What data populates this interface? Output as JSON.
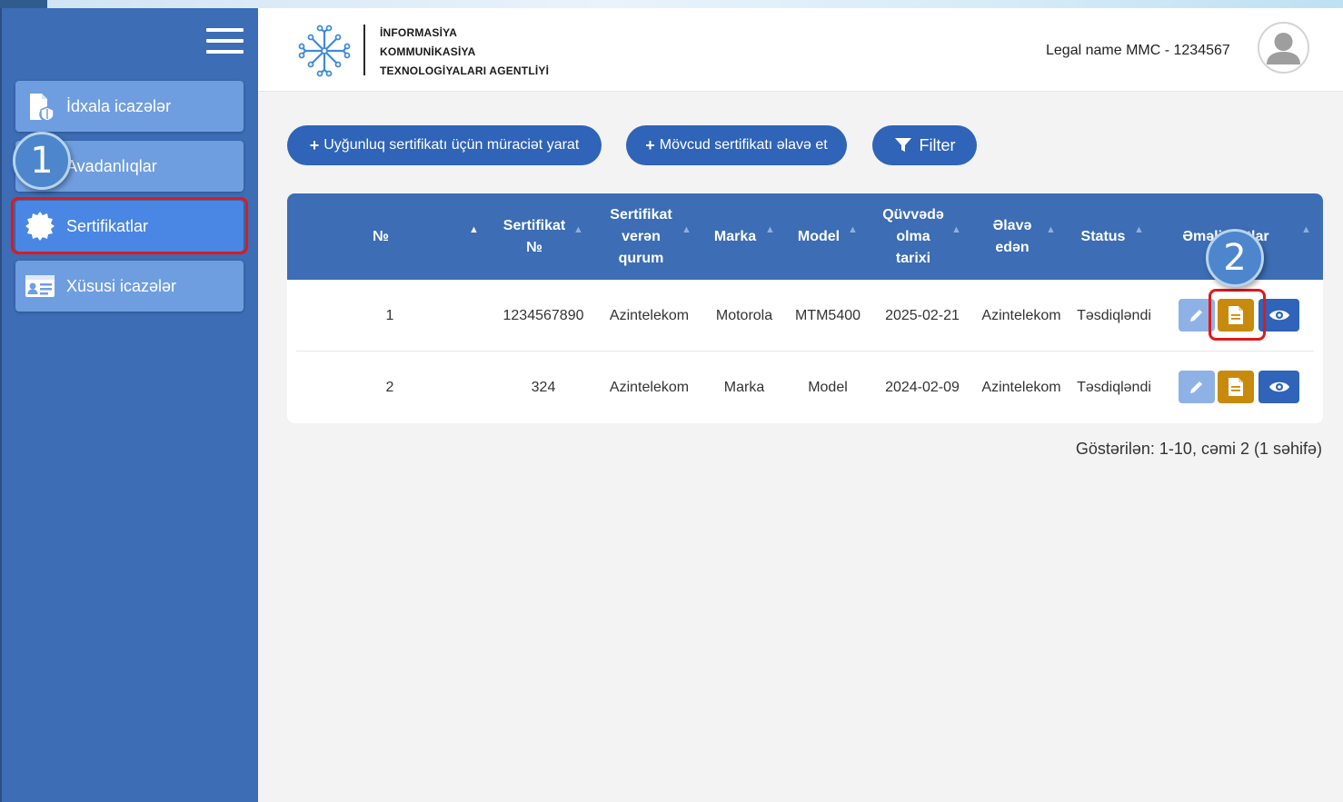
{
  "sidebar": {
    "items": [
      {
        "label": "İdxala icazələr",
        "icon": "import-permit-icon"
      },
      {
        "label": "Avadanlıqlar",
        "icon": "equipment-icon"
      },
      {
        "label": "Sertifikatlar",
        "icon": "certificate-badge-icon",
        "active": true
      },
      {
        "label": "Xüsusi icazələr",
        "icon": "id-card-icon"
      }
    ]
  },
  "header": {
    "agency_lines": [
      "İNFORMASİYA",
      "KOMMUNİKASİYA",
      "TEXNOLOGİYALARI AGENTLİYİ"
    ],
    "legal_name": "Legal name MMC - 1234567"
  },
  "toolbar": {
    "create_label": "Uyğunluq sertifikatı üçün müraciət yarat",
    "add_existing_label": "Mövcud sertifikatı əlavə et",
    "filter_label": "Filter"
  },
  "table": {
    "columns": [
      "№",
      "Sertifikat №",
      "Sertifikat verən qurum",
      "Marka",
      "Model",
      "Qüvvədə olma tarixi",
      "Əlavə edən",
      "Status",
      "Əməliyyatlar"
    ],
    "column_lines": {
      "cert_no": [
        "Sertifikat",
        "№"
      ],
      "issuer": [
        "Sertifikat",
        "verən",
        "qurum"
      ],
      "valid": [
        "Qüvvədə",
        "olma",
        "tarixi"
      ],
      "added_by": [
        "Əlavə",
        "edən"
      ]
    },
    "rows": [
      {
        "no": "1",
        "cert_no": "1234567890",
        "issuer": "Azintelekom",
        "brand": "Motorola",
        "model": "MTM5400",
        "valid_date": "2025-02-21",
        "added_by": "Azintelekom",
        "status": "Təsdiqləndi"
      },
      {
        "no": "2",
        "cert_no": "324",
        "issuer": "Azintelekom",
        "brand": "Marka",
        "model": "Model",
        "valid_date": "2024-02-09",
        "added_by": "Azintelekom",
        "status": "Təsdiqləndi"
      }
    ]
  },
  "pagination": {
    "info": "Göstərilən: 1-10, cəmi 2 (1 səhifə)"
  },
  "annotations": {
    "step1": "1",
    "step2": "2"
  },
  "colors": {
    "sidebar": "#3c6db5",
    "nav_item": "#6f9ee0",
    "nav_active": "#4a86e3",
    "primary": "#2f64b8",
    "doc_button": "#c88a0c",
    "highlight": "#e0191b"
  }
}
